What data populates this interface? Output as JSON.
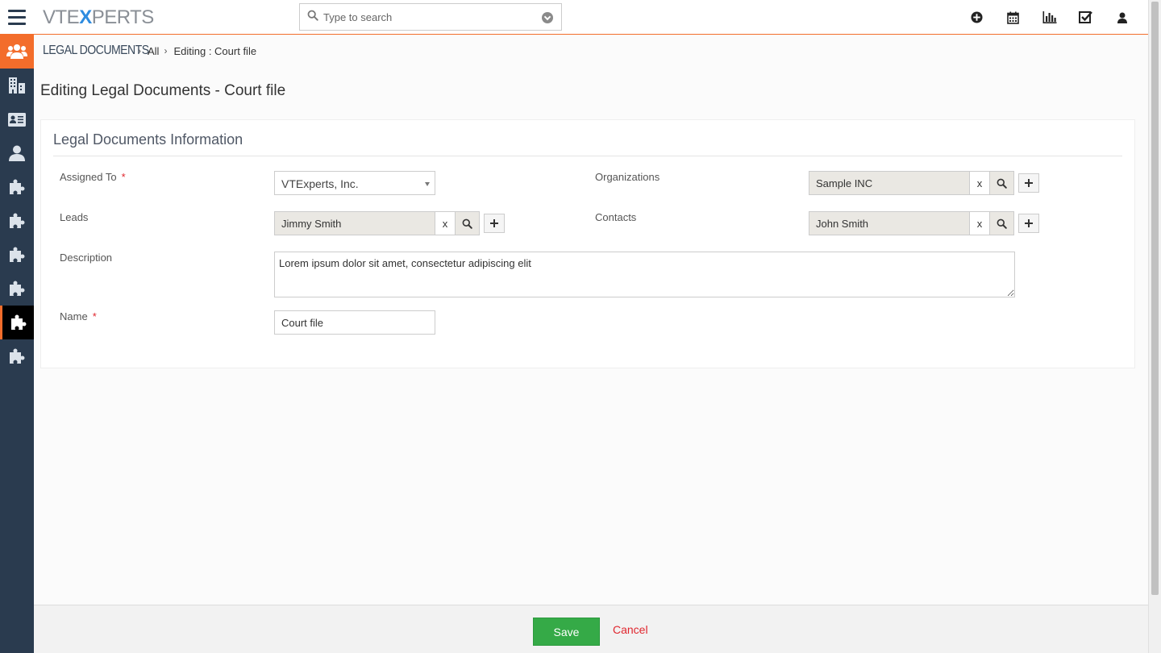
{
  "header": {
    "logo": {
      "part1": "VTE",
      "part2": "X",
      "part3": "PERTS"
    },
    "search_placeholder": "Type to search",
    "icons": [
      "plus-circle-icon",
      "calendar-icon",
      "bar-chart-icon",
      "checkbox-icon",
      "user-icon"
    ]
  },
  "sidebar": {
    "items": [
      {
        "icon": "users-icon"
      },
      {
        "icon": "building-icon"
      },
      {
        "icon": "contact-card-icon"
      },
      {
        "icon": "person-icon"
      },
      {
        "icon": "puzzle-icon"
      },
      {
        "icon": "puzzle-icon"
      },
      {
        "icon": "puzzle-icon"
      },
      {
        "icon": "puzzle-icon"
      },
      {
        "icon": "puzzle-icon"
      },
      {
        "icon": "puzzle-icon"
      }
    ]
  },
  "breadcrumb": {
    "module": "LEGAL DOCUMENTS",
    "all": "All",
    "current": "Editing : Court file"
  },
  "page_title": "Editing Legal Documents - Court file",
  "panel": {
    "title": "Legal Documents Information",
    "fields": {
      "assigned_to": {
        "label": "Assigned To",
        "required": "*",
        "value": "VTExperts, Inc."
      },
      "organizations": {
        "label": "Organizations",
        "value": "Sample INC",
        "clear": "x"
      },
      "leads": {
        "label": "Leads",
        "value": "Jimmy Smith",
        "clear": "x"
      },
      "contacts": {
        "label": "Contacts",
        "value": "John Smith",
        "clear": "x"
      },
      "description": {
        "label": "Description",
        "value": "Lorem ipsum dolor sit amet, consectetur adipiscing elit"
      },
      "name": {
        "label": "Name",
        "required": "*",
        "value": "Court file"
      }
    }
  },
  "footer": {
    "save_label": "Save",
    "cancel_label": "Cancel"
  },
  "colors": {
    "accent": "#f36d2b",
    "sidebar": "#2a3b4f",
    "save": "#35aa47",
    "cancel": "#e0262e"
  }
}
